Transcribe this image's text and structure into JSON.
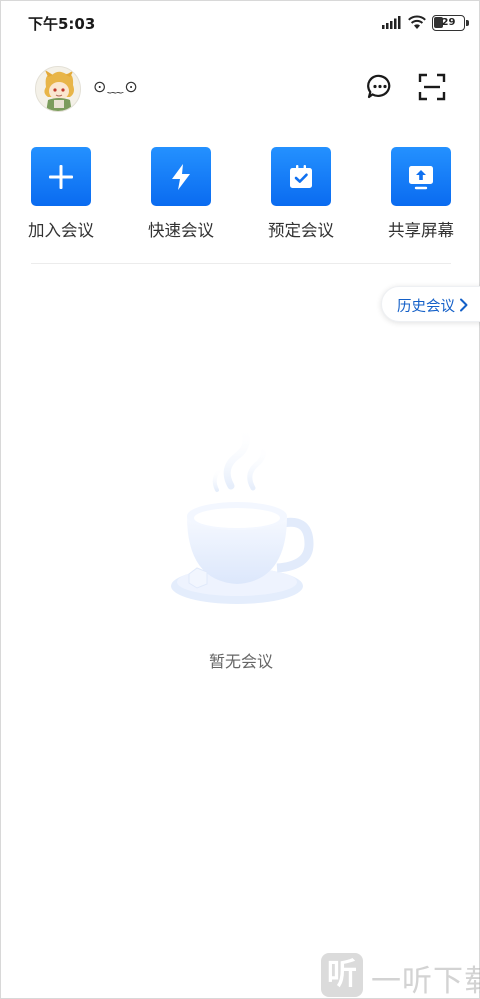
{
  "status_bar": {
    "time": "下午5:03",
    "battery": "29"
  },
  "header": {
    "nickname": "⊙﹏⊙"
  },
  "actions": [
    {
      "label": "加入会议",
      "icon": "plus-icon"
    },
    {
      "label": "快速会议",
      "icon": "lightning-icon"
    },
    {
      "label": "预定会议",
      "icon": "calendar-check-icon"
    },
    {
      "label": "共享屏幕",
      "icon": "share-screen-icon"
    }
  ],
  "history": {
    "label": "历史会议"
  },
  "empty_state": {
    "text": "暂无会议"
  },
  "watermark": {
    "badge": "听",
    "text": "一听下载"
  },
  "colors": {
    "accent": "#0a6bf0",
    "history_text": "#1460c8"
  }
}
